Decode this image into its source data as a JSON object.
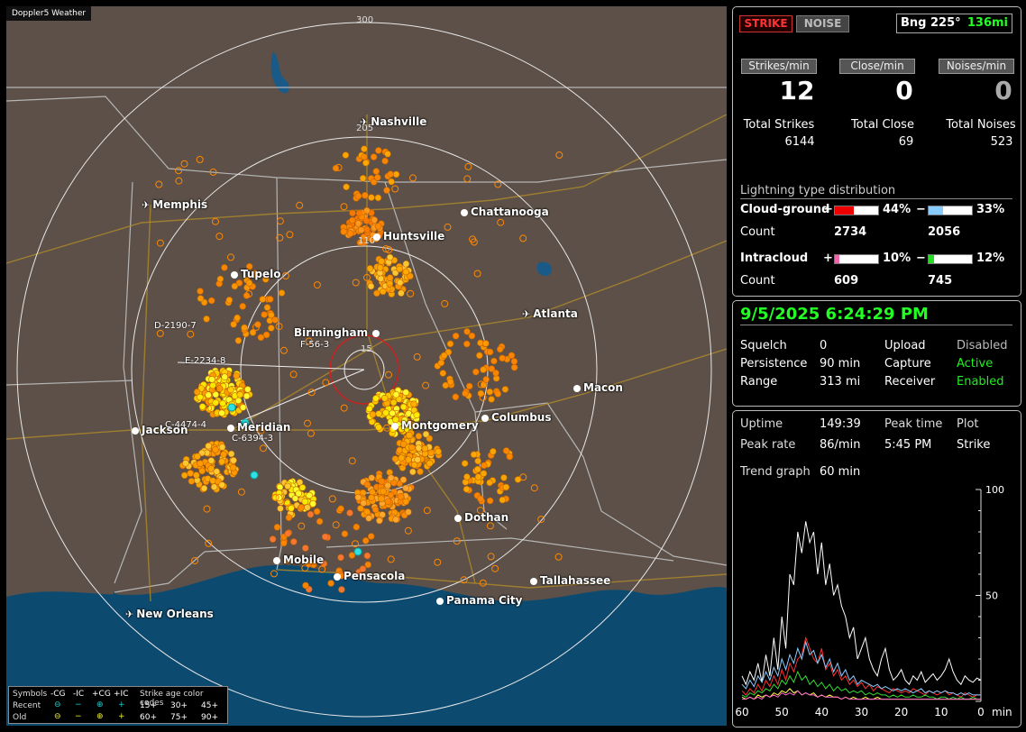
{
  "map": {
    "title": "Doppler5 Weather",
    "ring_labels": [
      "300",
      "205",
      "110",
      "15"
    ],
    "cities": [
      {
        "name": "Nashville",
        "type": "plane"
      },
      {
        "name": "Memphis",
        "type": "plane"
      },
      {
        "name": "Chattanooga",
        "type": "dot"
      },
      {
        "name": "Huntsville",
        "type": "dot"
      },
      {
        "name": "Tupelo",
        "type": "dot"
      },
      {
        "name": "Atlanta",
        "type": "plane"
      },
      {
        "name": "Birmingham",
        "type": "dot"
      },
      {
        "name": "Macon",
        "type": "dot"
      },
      {
        "name": "Jackson",
        "type": "dot"
      },
      {
        "name": "Meridian",
        "type": "dot"
      },
      {
        "name": "Montgomery",
        "type": "dot"
      },
      {
        "name": "Columbus",
        "type": "dot"
      },
      {
        "name": "Dothan",
        "type": "dot"
      },
      {
        "name": "Mobile",
        "type": "dot"
      },
      {
        "name": "Pensacola",
        "type": "dot"
      },
      {
        "name": "Tallahassee",
        "type": "dot"
      },
      {
        "name": "Panama City",
        "type": "dot"
      },
      {
        "name": "New Orleans",
        "type": "plane"
      }
    ],
    "cells": [
      "D-2190-7",
      "E-2234-8",
      "F-56-3",
      "C-4474-4",
      "C-6394-3"
    ],
    "legend": {
      "symbols_label": "Symbols",
      "headers": [
        "-CG",
        "-IC",
        "+CG",
        "+IC"
      ],
      "recent_label": "Recent",
      "old_label": "Old",
      "age_title": "Strike age color codes",
      "recent_ages": [
        "15+",
        "30+",
        "45+"
      ],
      "old_ages": [
        "60+",
        "75+",
        "90+"
      ],
      "recent_age_colors": [
        "#ffff30",
        "#ff9a00",
        "#ff7a30"
      ],
      "old_age_colors": [
        "#ffcc33",
        "#ff8800",
        "#ff5533"
      ]
    }
  },
  "status": {
    "strike_label": "STRIKE",
    "noise_label": "NOISE",
    "bearing": "Bng 225°",
    "range": "136mi",
    "strikes_min_label": "Strikes/min",
    "close_min_label": "Close/min",
    "noises_min_label": "Noises/min",
    "strikes_min": "12",
    "close_min": "0",
    "noises_min": "0",
    "total_strikes_label": "Total Strikes",
    "total_close_label": "Total Close",
    "total_noises_label": "Total Noises",
    "total_strikes": "6144",
    "total_close": "69",
    "total_noises": "523"
  },
  "distribution": {
    "title": "Lightning type distribution",
    "cg_label": "Cloud-ground",
    "ic_label": "Intracloud",
    "count_label": "Count",
    "cg_pos_pct": "44%",
    "cg_neg_pct": "33%",
    "ic_pos_pct": "10%",
    "ic_neg_pct": "12%",
    "cg_pos_frac": 0.44,
    "cg_neg_frac": 0.33,
    "ic_pos_frac": 0.1,
    "ic_neg_frac": 0.12,
    "cg_pos_count": "2734",
    "cg_neg_count": "2056",
    "ic_pos_count": "609",
    "ic_neg_count": "745",
    "plus": "+",
    "minus": "−"
  },
  "settings": {
    "datetime": "9/5/2025 6:24:29 PM",
    "squelch_label": "Squelch",
    "squelch": "0",
    "persistence_label": "Persistence",
    "persistence": "90 min",
    "range_label": "Range",
    "range": "313 mi",
    "upload_label": "Upload",
    "upload": "Disabled",
    "capture_label": "Capture",
    "capture": "Active",
    "receiver_label": "Receiver",
    "receiver": "Enabled"
  },
  "stats": {
    "uptime_label": "Uptime",
    "uptime": "149:39",
    "peak_time_label": "Peak time",
    "peak_time": "5:45 PM",
    "plot_label": "Plot",
    "plot": "Strike",
    "peak_rate_label": "Peak rate",
    "peak_rate": "86/min",
    "trend_label": "Trend graph",
    "trend": "60 min"
  },
  "chart_data": {
    "type": "line",
    "xlabel": "min",
    "x_ticks": [
      "60",
      "50",
      "40",
      "30",
      "20",
      "10",
      "0"
    ],
    "y_ticks": [
      "100",
      "50"
    ],
    "ylim": [
      0,
      100
    ],
    "xlim": [
      60,
      0
    ],
    "series": [
      {
        "color": "#ffffff",
        "values": [
          12,
          8,
          14,
          10,
          18,
          9,
          22,
          12,
          30,
          15,
          40,
          25,
          60,
          55,
          80,
          70,
          85,
          75,
          80,
          60,
          75,
          55,
          65,
          50,
          55,
          45,
          40,
          30,
          35,
          20,
          25,
          30,
          20,
          15,
          12,
          20,
          25,
          15,
          10,
          12,
          15,
          10,
          8,
          12,
          10,
          14,
          9,
          11,
          13,
          10,
          12,
          15,
          20,
          14,
          10,
          8,
          12,
          10,
          9,
          11,
          10
        ]
      },
      {
        "color": "#ff3030",
        "values": [
          5,
          3,
          6,
          4,
          8,
          5,
          10,
          7,
          12,
          8,
          15,
          10,
          18,
          14,
          20,
          22,
          30,
          25,
          20,
          18,
          25,
          15,
          18,
          12,
          15,
          10,
          12,
          8,
          10,
          7,
          9,
          6,
          8,
          5,
          7,
          6,
          5,
          4,
          6,
          5,
          4,
          5,
          4,
          6,
          5,
          4,
          3,
          5,
          4,
          3,
          4,
          5,
          3,
          4,
          3,
          2,
          4,
          3,
          2,
          3,
          3
        ]
      },
      {
        "color": "#88ccff",
        "values": [
          8,
          6,
          10,
          7,
          12,
          9,
          14,
          10,
          16,
          12,
          20,
          15,
          22,
          18,
          25,
          20,
          28,
          22,
          24,
          18,
          22,
          16,
          20,
          14,
          18,
          12,
          15,
          10,
          12,
          8,
          10,
          9,
          8,
          7,
          8,
          6,
          7,
          6,
          5,
          6,
          5,
          6,
          5,
          4,
          5,
          6,
          4,
          5,
          4,
          5,
          4,
          5,
          4,
          4,
          3,
          4,
          3,
          4,
          3,
          3,
          3
        ]
      },
      {
        "color": "#33dd33",
        "values": [
          3,
          2,
          4,
          3,
          5,
          4,
          6,
          5,
          8,
          6,
          10,
          8,
          12,
          9,
          14,
          10,
          12,
          8,
          10,
          7,
          9,
          6,
          8,
          5,
          7,
          5,
          6,
          4,
          5,
          4,
          5,
          3,
          4,
          3,
          4,
          3,
          3,
          2,
          3,
          2,
          3,
          2,
          2,
          3,
          2,
          2,
          3,
          2,
          2,
          1,
          2,
          2,
          1,
          2,
          1,
          2,
          1,
          1,
          2,
          1,
          1
        ]
      },
      {
        "color": "#ffff40",
        "values": [
          2,
          1,
          2,
          1,
          3,
          2,
          3,
          2,
          4,
          3,
          5,
          4,
          6,
          4,
          5,
          3,
          4,
          3,
          4,
          2,
          3,
          2,
          3,
          2,
          2,
          1,
          2,
          1,
          2,
          1,
          1,
          2,
          1,
          1,
          2,
          1,
          1,
          1,
          1,
          1,
          1,
          1,
          1,
          1,
          1,
          1,
          1,
          1,
          1,
          1,
          1,
          1,
          1,
          1,
          1,
          1,
          1,
          1,
          1,
          1,
          1
        ]
      },
      {
        "color": "#ff66cc",
        "values": [
          1,
          1,
          2,
          1,
          2,
          1,
          3,
          2,
          3,
          2,
          4,
          3,
          4,
          3,
          5,
          3,
          4,
          3,
          3,
          2,
          3,
          2,
          2,
          2,
          2,
          1,
          2,
          1,
          1,
          1,
          1,
          1,
          1,
          1,
          1,
          1,
          1,
          1,
          1,
          1,
          1,
          1,
          1,
          1,
          1,
          1,
          1,
          1,
          1,
          1,
          1,
          1,
          1,
          1,
          1,
          1,
          1,
          1,
          1,
          1,
          1
        ]
      }
    ]
  }
}
